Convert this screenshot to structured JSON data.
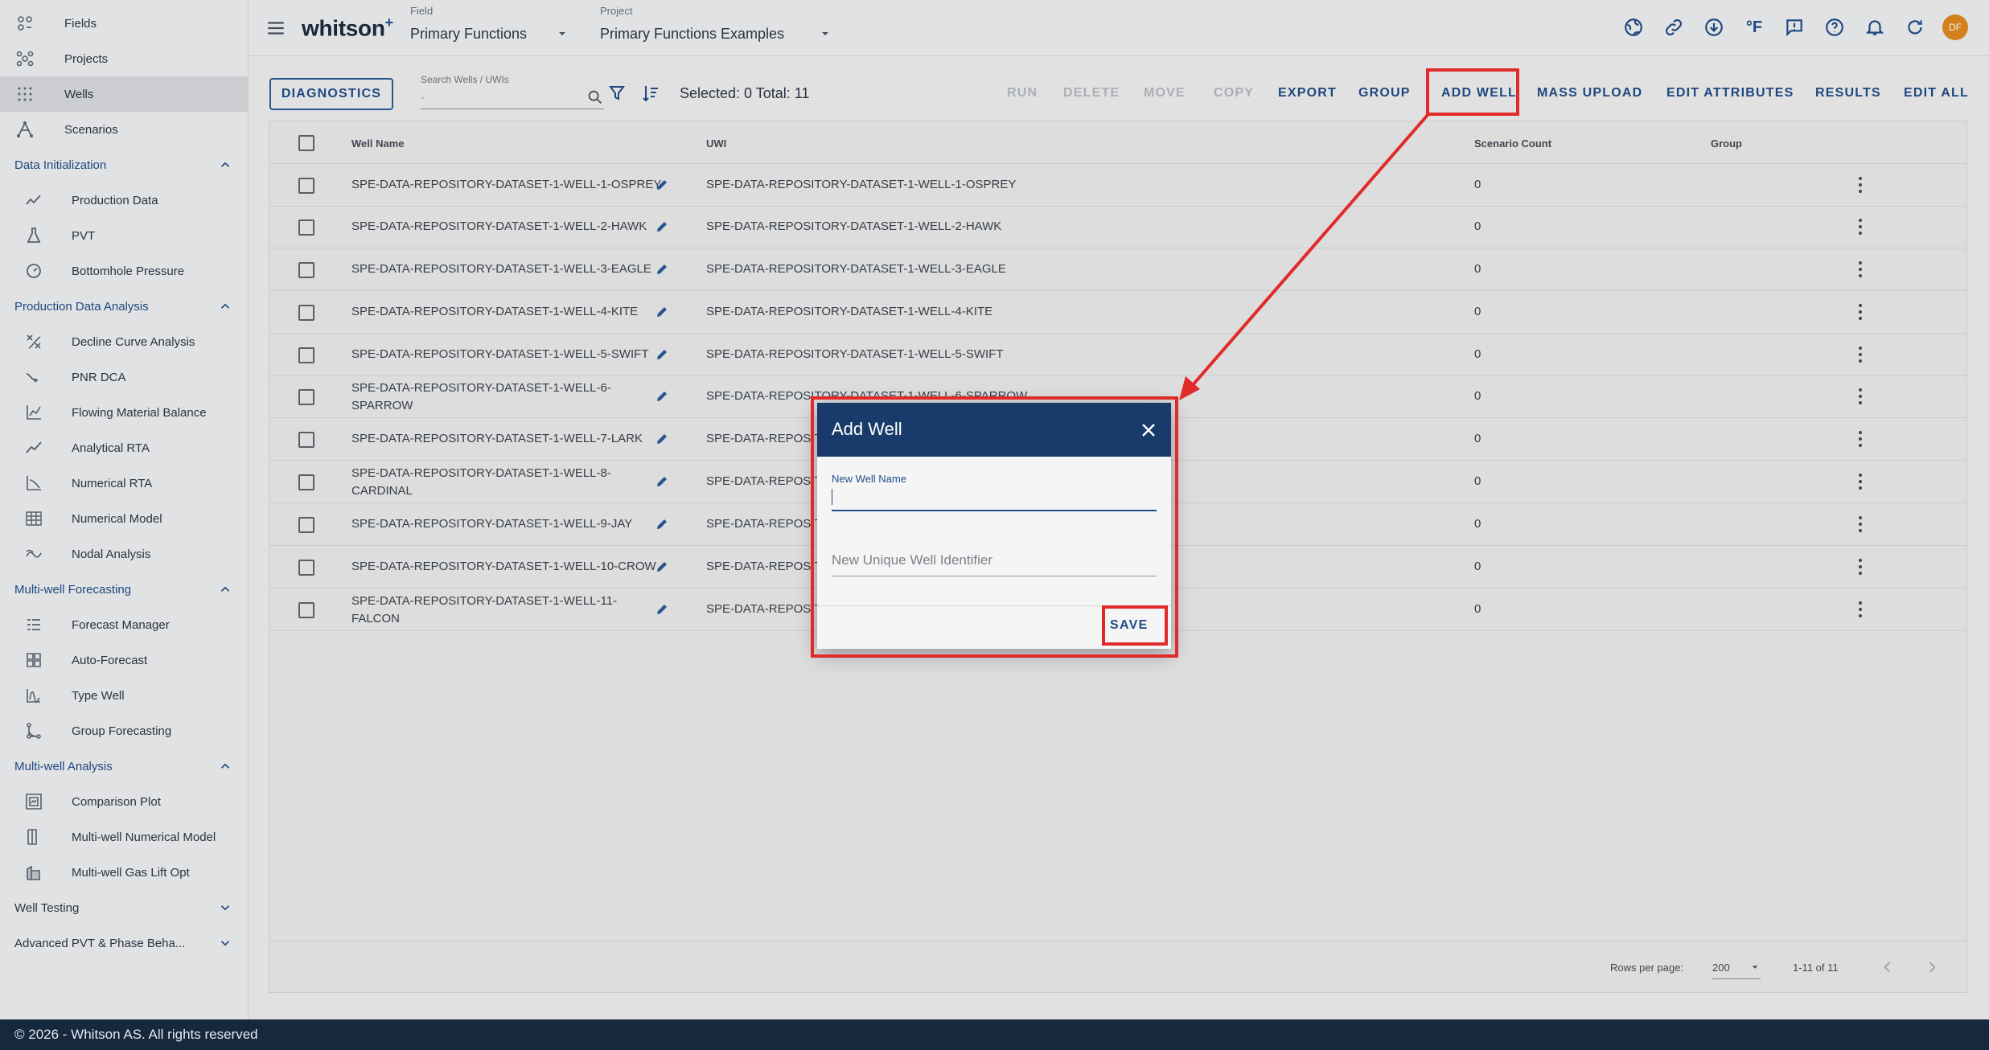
{
  "sidebar": {
    "top_items": [
      {
        "label": "Fields",
        "icon": "fields-icon"
      },
      {
        "label": "Projects",
        "icon": "projects-icon"
      },
      {
        "label": "Wells",
        "icon": "wells-icon",
        "active": true
      },
      {
        "label": "Scenarios",
        "icon": "scenarios-icon"
      }
    ],
    "sections": [
      {
        "label": "Data Initialization",
        "expanded": true,
        "items": [
          "Production Data",
          "PVT",
          "Bottomhole Pressure"
        ]
      },
      {
        "label": "Production Data Analysis",
        "expanded": true,
        "items": [
          "Decline Curve Analysis",
          "PNR DCA",
          "Flowing Material Balance",
          "Analytical RTA",
          "Numerical RTA",
          "Numerical Model",
          "Nodal Analysis"
        ]
      },
      {
        "label": "Multi-well Forecasting",
        "expanded": true,
        "items": [
          "Forecast Manager",
          "Auto-Forecast",
          "Type Well",
          "Group Forecasting"
        ]
      },
      {
        "label": "Multi-well Analysis",
        "expanded": true,
        "items": [
          "Comparison Plot",
          "Multi-well Numerical Model",
          "Multi-well Gas Lift Opt"
        ]
      },
      {
        "label": "Well Testing",
        "expanded": false,
        "items": []
      },
      {
        "label": "Advanced PVT & Phase Beha...",
        "expanded": false,
        "items": []
      }
    ]
  },
  "header": {
    "logo": "whitson",
    "logo_sup": "+",
    "field_caption": "Field",
    "field_value": "Primary Functions",
    "project_caption": "Project",
    "project_value": "Primary Functions Examples",
    "temp_unit": "°F",
    "avatar_initials": "DF"
  },
  "toolbar": {
    "diagnostics": "DIAGNOSTICS",
    "search_caption": "Search Wells / UWIs",
    "search_placeholder": "-",
    "selection_info": "Selected: 0 Total: 11",
    "actions": [
      {
        "label": "RUN",
        "enabled": false
      },
      {
        "label": "DELETE",
        "enabled": false
      },
      {
        "label": "MOVE",
        "enabled": false
      },
      {
        "label": "COPY",
        "enabled": false
      },
      {
        "label": "EXPORT",
        "enabled": true
      },
      {
        "label": "GROUP",
        "enabled": true
      },
      {
        "label": "ADD WELL",
        "enabled": true
      },
      {
        "label": "MASS UPLOAD",
        "enabled": true
      },
      {
        "label": "EDIT ATTRIBUTES",
        "enabled": true
      },
      {
        "label": "RESULTS",
        "enabled": true
      },
      {
        "label": "EDIT ALL",
        "enabled": true
      }
    ]
  },
  "table": {
    "columns": [
      "Well Name",
      "UWI",
      "Scenario Count",
      "Group"
    ],
    "rows": [
      {
        "name": [
          "SPE-DATA-REPOSITORY-DATASET-1-WELL-1-OSPREY"
        ],
        "uwi": "SPE-DATA-REPOSITORY-DATASET-1-WELL-1-OSPREY",
        "count": "0"
      },
      {
        "name": [
          "SPE-DATA-REPOSITORY-DATASET-1-WELL-2-HAWK"
        ],
        "uwi": "SPE-DATA-REPOSITORY-DATASET-1-WELL-2-HAWK",
        "count": "0"
      },
      {
        "name": [
          "SPE-DATA-REPOSITORY-DATASET-1-WELL-3-EAGLE"
        ],
        "uwi": "SPE-DATA-REPOSITORY-DATASET-1-WELL-3-EAGLE",
        "count": "0"
      },
      {
        "name": [
          "SPE-DATA-REPOSITORY-DATASET-1-WELL-4-KITE"
        ],
        "uwi": "SPE-DATA-REPOSITORY-DATASET-1-WELL-4-KITE",
        "count": "0"
      },
      {
        "name": [
          "SPE-DATA-REPOSITORY-DATASET-1-WELL-5-SWIFT"
        ],
        "uwi": "SPE-DATA-REPOSITORY-DATASET-1-WELL-5-SWIFT",
        "count": "0"
      },
      {
        "name": [
          "SPE-DATA-REPOSITORY-DATASET-1-WELL-6-",
          "SPARROW"
        ],
        "uwi": "SPE-DATA-REPOSITORY-DATASET-1-WELL-6-SPARROW",
        "count": "0"
      },
      {
        "name": [
          "SPE-DATA-REPOSITORY-DATASET-1-WELL-7-LARK"
        ],
        "uwi": "SPE-DATA-REPOSITORY-DATASET-1-WELL-7-LARK",
        "count": "0"
      },
      {
        "name": [
          "SPE-DATA-REPOSITORY-DATASET-1-WELL-8-",
          "CARDINAL"
        ],
        "uwi": "SPE-DATA-REPOSITORY-DATASET-1-WELL-8-CARDINAL",
        "count": "0"
      },
      {
        "name": [
          "SPE-DATA-REPOSITORY-DATASET-1-WELL-9-JAY"
        ],
        "uwi": "SPE-DATA-REPOSITORY-DATASET-1-WELL-9-JAY",
        "count": "0"
      },
      {
        "name": [
          "SPE-DATA-REPOSITORY-DATASET-1-WELL-10-CROW"
        ],
        "uwi": "SPE-DATA-REPOSITORY-DATASET-1-WELL-10-CROW",
        "count": "0"
      },
      {
        "name": [
          "SPE-DATA-REPOSITORY-DATASET-1-WELL-11-",
          "FALCON"
        ],
        "uwi": "SPE-DATA-REPOSITORY-DATASET-1-WELL-11-FALCON",
        "count": "0"
      }
    ],
    "rows_per_page_label": "Rows per page:",
    "rows_per_page_value": "200",
    "pagination_info": "1-11 of 11"
  },
  "dialog": {
    "title": "Add Well",
    "well_name_label": "New Well Name",
    "well_name_value": "",
    "uwi_placeholder": "New Unique Well Identifier",
    "save": "SAVE"
  },
  "footer": {
    "copyright": "© 2026 - Whitson AS. All rights reserved"
  },
  "colors": {
    "primary": "#1f4d87",
    "dialog_header": "#183b6b",
    "annotation_red": "#e12a2a",
    "footer_bg": "#16283e",
    "avatar": "#e08a1f"
  }
}
